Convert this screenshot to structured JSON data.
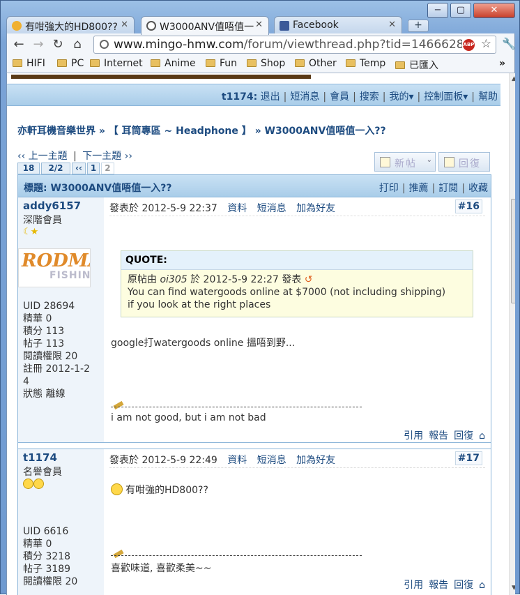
{
  "tabs": [
    {
      "title": "有咁強大的HD800??",
      "active": false
    },
    {
      "title": "W3000ANV值唔值一",
      "active": true
    },
    {
      "title": "Facebook",
      "active": false
    }
  ],
  "window_controls": {
    "minimize": "−",
    "maximize": "▢",
    "close": "✕"
  },
  "address": {
    "host": "www.mingo-hmw.com",
    "path": "/forum/viewthread.php?tid=1466628"
  },
  "bookmarks": [
    "HIFI",
    "PC",
    "Internet",
    "Anime",
    "Fun",
    "Shop",
    "Other",
    "Temp",
    "已匯入"
  ],
  "userbar": {
    "user": "t1174:",
    "links": [
      "退出",
      "短消息",
      "會員",
      "搜索",
      "我的▾",
      "控制面板▾",
      "幫助"
    ]
  },
  "breadcrumb": "亦軒耳機音樂世界 » 【 耳筒專區 ~ Headphone 】 » W3000ANV值唔值一入??",
  "nav_links": {
    "prev": "‹‹ 上一主題",
    "next": "下一主題 ››"
  },
  "pager": [
    "18",
    "2/2",
    "‹‹",
    "1",
    "2"
  ],
  "buttons": {
    "new_post": "新帖",
    "reply": "回復"
  },
  "thread": {
    "title": "標題: W3000ANV值唔值一入??",
    "actions": [
      "打印",
      "推薦",
      "訂閱",
      "收藏"
    ]
  },
  "posts": [
    {
      "author": "addy6157",
      "rank": "深階會員",
      "stats": [
        "UID 28694",
        "精華 0",
        "積分 113",
        "帖子 113",
        "閱讀權限 20",
        "註冊 2012-1-2",
        "4",
        "狀態 離線"
      ],
      "posted": "發表於 2012-5-9 22:37",
      "links": [
        "資料",
        "短消息",
        "加為好友"
      ],
      "number": "#16",
      "quote": {
        "header": "QUOTE:",
        "line1_prefix": "原帖由",
        "line1_user": "oi305",
        "line1_rest": "於 2012-5-9 22:27 發表",
        "line2": "You can find watergoods online at $7000 (not including shipping)",
        "line3": "if you look at the right places"
      },
      "text": "google打watergoods online 搵唔到野...",
      "signature": "i am not good, but i am not bad",
      "footer": [
        "引用",
        "報告",
        "回復"
      ]
    },
    {
      "author": "t1174",
      "rank": "名譽會員",
      "stats": [
        "UID 6616",
        "精華 0",
        "積分 3218",
        "帖子 3189",
        "閱讀權限 20"
      ],
      "posted": "發表於 2012-5-9 22:49",
      "links": [
        "資料",
        "短消息",
        "加為好友"
      ],
      "number": "#17",
      "text": "有咁強的HD800??",
      "signature": "喜歡味道, 喜歡柔美~~",
      "footer": [
        "引用",
        "報告",
        "回復"
      ]
    }
  ],
  "logo_text": {
    "top": "RODMA",
    "bottom": "FISHIN"
  },
  "colors": {
    "link": "#1d4b80",
    "header_bg": "#a9cde9",
    "sidebar_bg": "#eef4fa"
  }
}
